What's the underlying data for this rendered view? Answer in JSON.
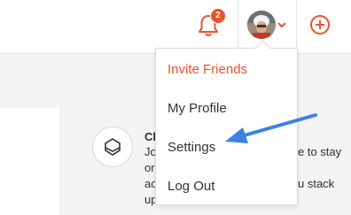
{
  "topbar": {
    "notifications": {
      "icon": "bell-icon",
      "badge_count": "2"
    },
    "user": {
      "avatar_icon": "avatar",
      "menu_icon": "chevron-down-icon"
    },
    "add": {
      "icon": "plus-circle-icon"
    }
  },
  "dropdown": {
    "items": [
      {
        "label": "Invite Friends",
        "accent": true
      },
      {
        "label": "My Profile"
      },
      {
        "label": "Settings"
      },
      {
        "label": "Log Out"
      }
    ]
  },
  "background": {
    "feature_title_fragment": "Cl",
    "line1_left": "Jo",
    "line1_right": "e to stay",
    "line2_left": "or",
    "line3_left": "ac",
    "line3_right": "u stack",
    "line4_left": "up"
  },
  "annotation": {
    "arrow_icon": "pointer-arrow",
    "arrow_color": "#3b82e8"
  },
  "colors": {
    "accent": "#e8542d",
    "annotation": "#3b82e8"
  }
}
